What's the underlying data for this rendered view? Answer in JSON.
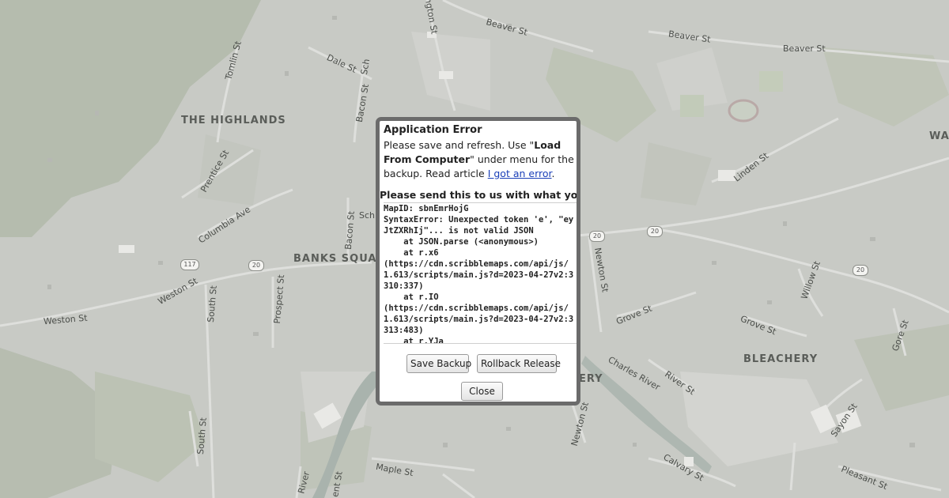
{
  "map": {
    "streets": [
      "Beaver St",
      "Beaver St",
      "Beaver St",
      "Tomlin St",
      "Dale St",
      "Bacon St",
      "Prentice St",
      "Columbia Ave",
      "Bacon St",
      "Linden St",
      "Weston St",
      "Weston St",
      "South St",
      "Prospect St",
      "Newton St",
      "Grove St",
      "Grove St",
      "Willow St",
      "Gore St",
      "River St",
      "Charles River",
      "Sayon St",
      "Maple St",
      "Newton St",
      "Calvary St",
      "Pleasant St",
      "South St",
      "ington St",
      "Sch",
      "Sch",
      "ent St",
      "River"
    ],
    "districts": [
      "THE HIGHLANDS",
      "BANKS SQUARE",
      "BLEACHERY",
      "WA",
      "ERY"
    ],
    "routes": [
      "20",
      "20",
      "20",
      "20",
      "117"
    ]
  },
  "dialog": {
    "title": "Application Error",
    "message_part1": "Please save and refresh. Use \"",
    "message_bold": "Load From Computer",
    "message_part2": "\" under menu for the backup. Read article ",
    "message_link": "I got an error",
    "message_end": ".",
    "send_heading": "Please send this to us with what you",
    "error_log": "MapID: sbnEmrHojG\nSyntaxError: Unexpected token 'e', \"eyJtZXRhIj\"... is not valid JSON\n    at JSON.parse (<anonymous>)\n    at r.x6\n(https://cdn.scribblemaps.com/api/js/1.613/scripts/main.js?d=2023-04-27v2:3310:337)\n    at r.IO\n(https://cdn.scribblemaps.com/api/js/1.613/scripts/main.js?d=2023-04-27v2:3313:483)\n    at r.YJa",
    "save_backup_label": "Save Backup",
    "rollback_label": "Rollback Release",
    "close_label": "Close"
  }
}
